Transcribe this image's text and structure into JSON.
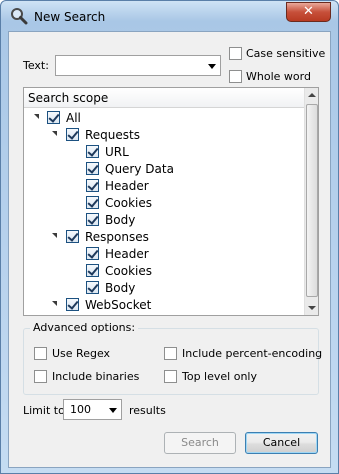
{
  "window": {
    "title": "New Search",
    "close_glyph": "✕"
  },
  "text_field": {
    "label": "Text:",
    "value": ""
  },
  "options": {
    "case_sensitive": "Case sensitive",
    "whole_word": "Whole word"
  },
  "scope": {
    "header": "Search scope",
    "items": [
      {
        "label": "All",
        "checked": true
      },
      {
        "label": "Requests",
        "checked": true
      },
      {
        "label": "URL",
        "checked": true
      },
      {
        "label": "Query Data",
        "checked": true
      },
      {
        "label": "Header",
        "checked": true
      },
      {
        "label": "Cookies",
        "checked": true
      },
      {
        "label": "Body",
        "checked": true
      },
      {
        "label": "Responses",
        "checked": true
      },
      {
        "label": "Header",
        "checked": true
      },
      {
        "label": "Cookies",
        "checked": true
      },
      {
        "label": "Body",
        "checked": true
      },
      {
        "label": "WebSocket",
        "checked": true
      }
    ]
  },
  "advanced": {
    "legend": "Advanced options:",
    "use_regex": "Use Regex",
    "include_percent": "Include percent-encoding",
    "include_binaries": "Include binaries",
    "top_level_only": "Top level only"
  },
  "limit": {
    "label": "Limit to",
    "value": "100",
    "suffix": "results"
  },
  "buttons": {
    "search": "Search",
    "cancel": "Cancel"
  }
}
